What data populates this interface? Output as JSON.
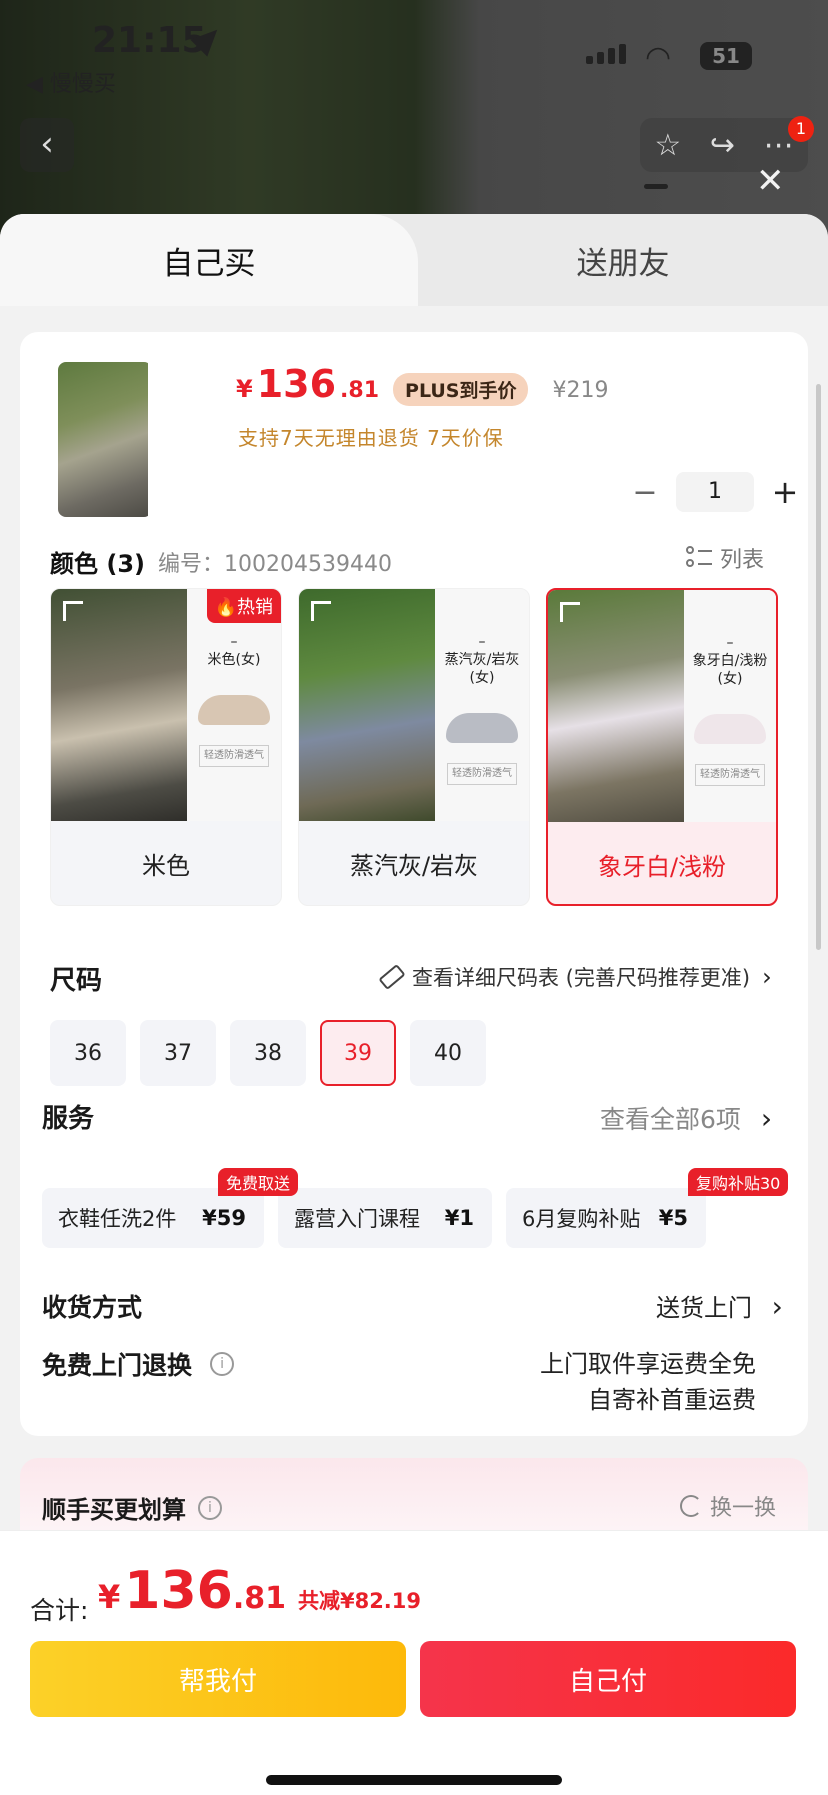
{
  "status_bar": {
    "time": "21:15",
    "back_app": "◀ 慢慢买",
    "battery": "51"
  },
  "nav": {
    "back": "‹",
    "badge": "1"
  },
  "tabs": {
    "self_buy": "自己买",
    "gift": "送朋友"
  },
  "product": {
    "thumb_label": "–\n象牙白/浅粉\n(女)",
    "price_symbol": "¥",
    "price_int": "136",
    "price_dec": ".81",
    "plus_badge": "PLUS到手价",
    "original_price": "¥219",
    "guarantee": "支持7天无理由退货   7天价保",
    "quantity": "1"
  },
  "color_section": {
    "title": "颜色 (3)",
    "sku": "编号：100204539440",
    "list_view": "列表",
    "hot_tag": "🔥热销",
    "swatches": [
      {
        "label": "米色",
        "side_text": "–\n米色(女)",
        "tag": "轻透防滑透气"
      },
      {
        "label": "蒸汽灰/岩灰",
        "side_text": "–\n蒸汽灰/岩灰\n(女)",
        "tag": "轻透防滑透气"
      },
      {
        "label": "象牙白/浅粉",
        "side_text": "–\n象牙白/浅粉\n(女)",
        "tag": "轻透防滑透气"
      }
    ]
  },
  "size_section": {
    "title": "尺码",
    "chart_link": "查看详细尺码表 (完善尺码推荐更准)",
    "sizes": [
      "36",
      "37",
      "38",
      "39",
      "40"
    ],
    "selected": "39"
  },
  "service_section": {
    "title": "服务",
    "view_all": "查看全部6项",
    "items": [
      {
        "name": "衣鞋任洗2件",
        "price": "¥59",
        "tag": "免费取送"
      },
      {
        "name": "露营入门课程",
        "price": "¥1",
        "tag": ""
      },
      {
        "name": "6月复购补贴",
        "price": "¥5",
        "tag": "复购补贴30"
      }
    ]
  },
  "delivery": {
    "title": "收货方式",
    "value": "送货上门"
  },
  "returns": {
    "title": "免费上门退换",
    "line1": "上门取件享运费全免",
    "line2": "自寄补首重运费"
  },
  "upsell": {
    "title": "顺手买更划算",
    "swap": "换一换"
  },
  "footer": {
    "total_label": "合计:",
    "total_symbol": "¥",
    "total_int": "136",
    "total_dec": ".81",
    "saved": "共减¥82.19",
    "help_pay": "帮我付",
    "self_pay": "自己付"
  },
  "colors": {
    "accent": "#e8202a",
    "gold": "#c4862c",
    "help_button": "#fcc419"
  }
}
